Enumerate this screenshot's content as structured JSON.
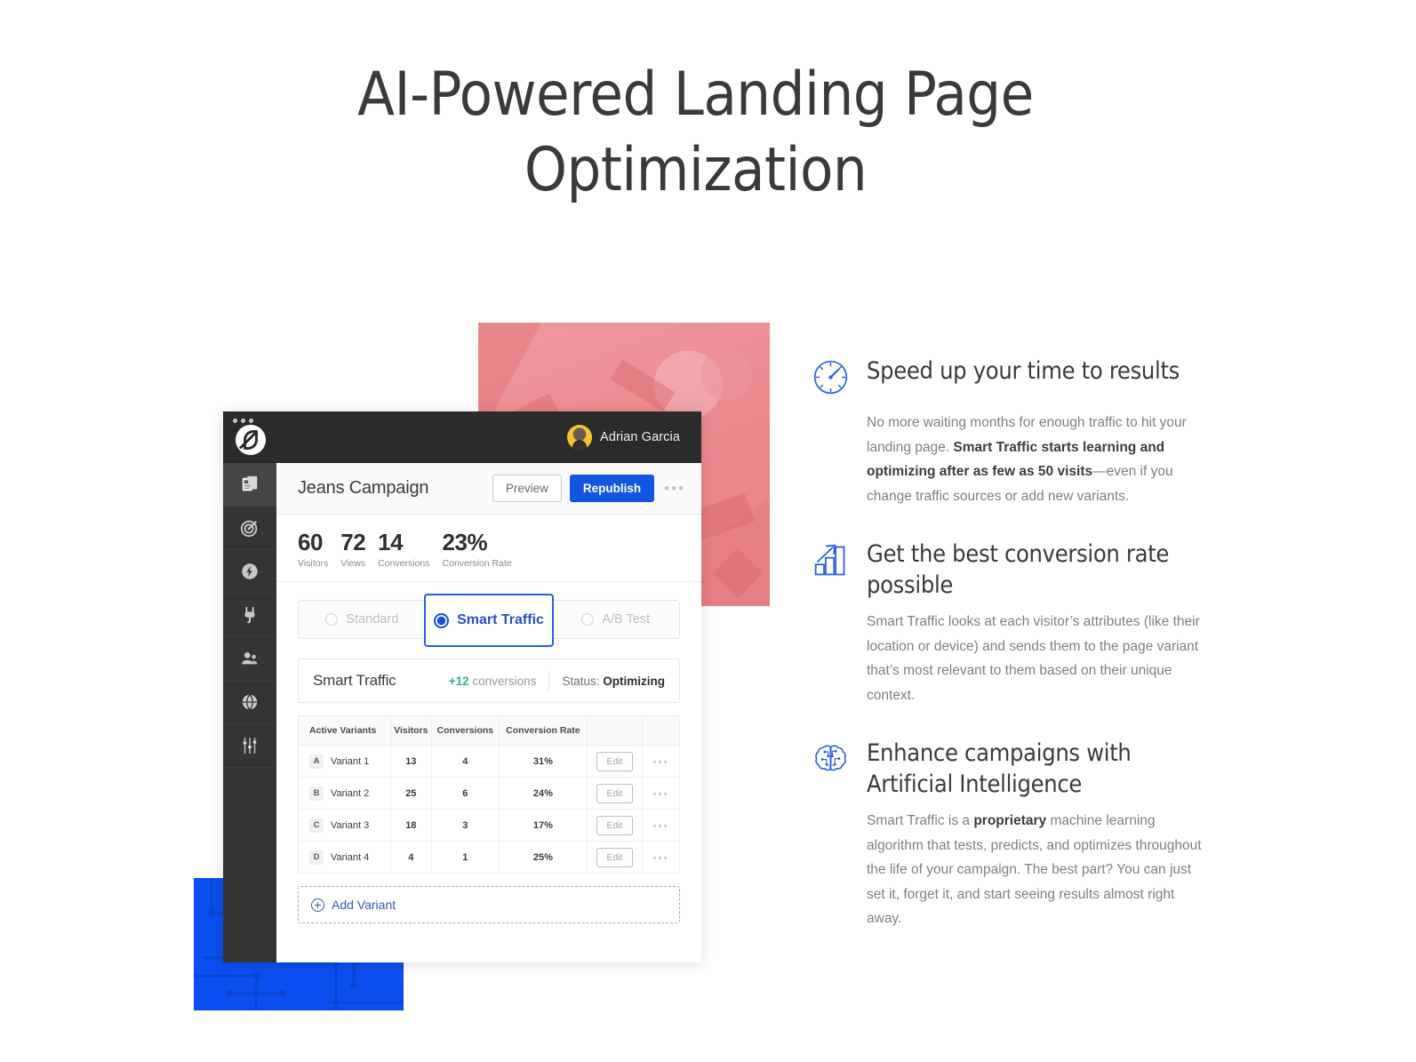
{
  "hero": {
    "title_line1": "AI-Powered Landing Page",
    "title_line2": "Optimization"
  },
  "app": {
    "user": {
      "name": "Adrian Garcia",
      "avatar_icon": "user-avatar"
    },
    "logo_icon": "unbounce-logo-icon",
    "window_dots_icon": "window-dots-icon",
    "sidebar": [
      {
        "name": "pages",
        "icon": "pages-icon",
        "active": true
      },
      {
        "name": "goals",
        "icon": "target-icon",
        "active": false
      },
      {
        "name": "speed",
        "icon": "bolt-icon",
        "active": false
      },
      {
        "name": "integrations",
        "icon": "plug-icon",
        "active": false
      },
      {
        "name": "users",
        "icon": "users-icon",
        "active": false
      },
      {
        "name": "domains",
        "icon": "globe-icon",
        "active": false
      },
      {
        "name": "settings",
        "icon": "sliders-icon",
        "active": false
      }
    ],
    "header": {
      "campaign_title": "Jeans Campaign",
      "preview_label": "Preview",
      "republish_label": "Republish",
      "kebab_label": "•••"
    },
    "stats": [
      {
        "value": "60",
        "label": "Visitors"
      },
      {
        "value": "72",
        "label": "Views"
      },
      {
        "value": "14",
        "label": "Conversions"
      },
      {
        "value": "23%",
        "label": "Conversion Rate"
      }
    ],
    "modes": [
      {
        "label": "Standard",
        "selected": false
      },
      {
        "label": "Smart Traffic",
        "selected": true
      },
      {
        "label": "A/B Test",
        "selected": false
      }
    ],
    "smart_traffic_bar": {
      "name": "Smart Traffic",
      "conversions_delta": "+12",
      "conversions_word": "conversions",
      "status_label": "Status:",
      "status_value": "Optimizing",
      "delta_color": "#35b37e"
    },
    "variants_table": {
      "headers": [
        "Active Variants",
        "Visitors",
        "Conversions",
        "Conversion Rate",
        "",
        ""
      ],
      "rows": [
        {
          "badge": "A",
          "name": "Variant 1",
          "visitors": "13",
          "conversions": "4",
          "rate": "31%",
          "edit_label": "Edit",
          "more_label": "•••"
        },
        {
          "badge": "B",
          "name": "Variant 2",
          "visitors": "25",
          "conversions": "6",
          "rate": "24%",
          "edit_label": "Edit",
          "more_label": "•••"
        },
        {
          "badge": "C",
          "name": "Variant 3",
          "visitors": "18",
          "conversions": "3",
          "rate": "17%",
          "edit_label": "Edit",
          "more_label": "•••"
        },
        {
          "badge": "D",
          "name": "Variant 4",
          "visitors": "4",
          "conversions": "1",
          "rate": "25%",
          "edit_label": "Edit",
          "more_label": "•••"
        }
      ]
    },
    "add_variant_label": "Add Variant"
  },
  "features": [
    {
      "icon": "clock-icon",
      "title": "Speed up your time to results",
      "body_1": "No more waiting months for enough traffic to hit your landing page. ",
      "body_bold": "Smart Traffic starts learning and optimizing after as few as 50 visits",
      "body_2": "—even if you change traffic sources or add new variants."
    },
    {
      "icon": "bar-chart-up-icon",
      "title": "Get the best conversion rate possible",
      "body_1": "Smart Traffic looks at each visitor’s attributes (like their location or device) and sends them to the page variant that’s most relevant to them based on their unique context.",
      "body_bold": "",
      "body_2": ""
    },
    {
      "icon": "brain-icon",
      "title": "Enhance campaigns with Artificial Intelligence",
      "body_1": "Smart Traffic is a ",
      "body_bold": "proprietary",
      "body_2": " machine learning algorithm that tests, predicts, and optimizes throughout the life of your campaign. The best part? You can just set it, forget it, and start seeing results almost right away."
    }
  ],
  "decor": {
    "pink_photo": "decorative-pink-photo",
    "blue_block": "decorative-blue-circuit-block",
    "accent_blue": "#1255e0",
    "block_blue": "#0b4ff0",
    "pink": "#ec8a90"
  }
}
